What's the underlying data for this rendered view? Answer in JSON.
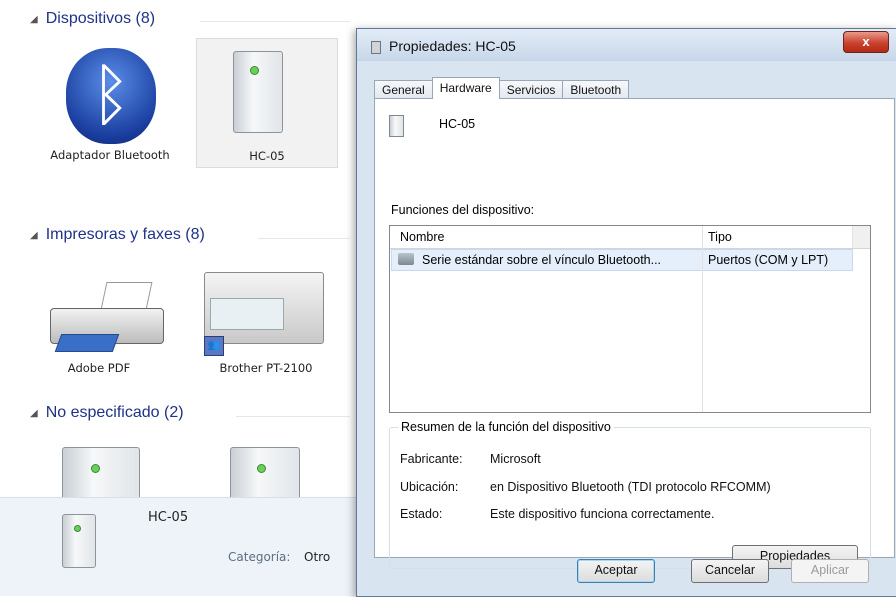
{
  "explorer": {
    "groups": [
      {
        "label": "Dispositivos (8)"
      },
      {
        "label": "Impresoras y faxes (8)"
      },
      {
        "label": "No especificado (2)"
      }
    ],
    "devices": [
      {
        "label": "Adaptador Bluetooth"
      },
      {
        "label": "HC-05"
      },
      {
        "label": "Adobe PDF"
      },
      {
        "label": "Brother PT-2100"
      }
    ],
    "details": {
      "name": "HC-05",
      "category_label": "Categoría:",
      "category_value": "Otro"
    }
  },
  "dialog": {
    "title": "Propiedades: HC-05",
    "close_label": "x",
    "tabs": [
      {
        "label": "General"
      },
      {
        "label": "Hardware"
      },
      {
        "label": "Servicios"
      },
      {
        "label": "Bluetooth"
      }
    ],
    "device_name": "HC-05",
    "functions_label": "Funciones del dispositivo:",
    "columns": {
      "name": "Nombre",
      "type": "Tipo"
    },
    "rows": [
      {
        "name": "Serie estándar sobre el vínculo Bluetooth...",
        "type": "Puertos (COM y LPT)"
      }
    ],
    "summary": {
      "title": "Resumen de la función del dispositivo",
      "manufacturer_label": "Fabricante:",
      "manufacturer_value": "Microsoft",
      "location_label": "Ubicación:",
      "location_value": "en Dispositivo Bluetooth (TDI protocolo RFCOMM)",
      "status_label": "Estado:",
      "status_value": "Este dispositivo funciona correctamente.",
      "properties_button": "Propiedades"
    },
    "buttons": {
      "ok": "Aceptar",
      "cancel": "Cancelar",
      "apply": "Aplicar"
    }
  }
}
